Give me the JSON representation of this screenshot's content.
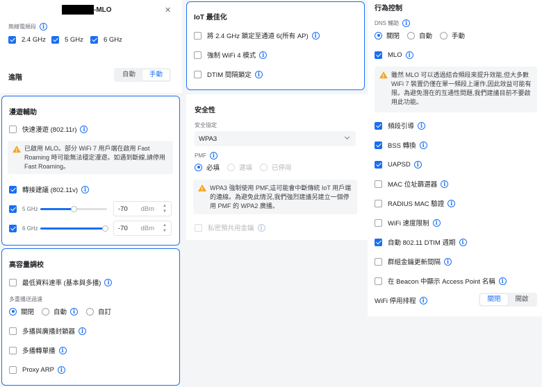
{
  "header": {
    "title_suffix": "-MLO",
    "close_glyph": "✕"
  },
  "radio_band": {
    "label": "無線電頻段",
    "bands": [
      {
        "label": "2.4 GHz",
        "checked": true
      },
      {
        "label": "5 GHz",
        "checked": true
      },
      {
        "label": "6 GHz",
        "checked": true
      }
    ]
  },
  "advanced": {
    "label": "進階",
    "options": [
      "自動",
      "手動"
    ],
    "selected": "手動"
  },
  "roaming": {
    "title": "漫遊輔助",
    "fast_roaming": {
      "label": "快速漫遊 (802.11r)",
      "checked": false
    },
    "warning": "已啟用 MLO。部分 WiFi 7 用戶端在啟用 Fast Roaming 時可能無法穩定漫遊。如遇到斷線,請停用 Fast Roaming。",
    "transition": {
      "label": "轉接建議 (802.11v)",
      "checked": true
    },
    "bands": [
      {
        "label": "5 GHz",
        "checked": true,
        "value": "-70",
        "unit": "dBm",
        "level": 0.5
      },
      {
        "label": "6 GHz",
        "checked": true,
        "value": "-70",
        "unit": "dBm",
        "level": 0.97
      }
    ]
  },
  "high_density": {
    "title": "高容量調校",
    "min_rate": {
      "label": "最低資料速率 (基本與多播)",
      "checked": false
    },
    "multicast_label": "多重播送過濾",
    "multicast_options": [
      "關閉",
      "自動",
      "自訂"
    ],
    "multicast_selected": "關閉",
    "broadcast_block": {
      "label": "多播與廣播封鎖器",
      "checked": false
    },
    "mcast_to_ucast": {
      "label": "多播轉單播",
      "checked": false
    },
    "proxy_arp": {
      "label": "Proxy ARP",
      "checked": false
    }
  },
  "iot": {
    "title": "IoT 最佳化",
    "items": [
      {
        "label": "將 2.4 GHz 鎖定至通道 6(所有 AP)",
        "checked": false
      },
      {
        "label": "強制 WiFi 4 模式",
        "checked": false
      },
      {
        "label": "DTIM 間隔鎖定",
        "checked": false
      }
    ]
  },
  "security": {
    "title": "安全性",
    "protocol_label": "安全協定",
    "protocol_value": "WPA3",
    "pmf_label": "PMF",
    "pmf_options": [
      "必填",
      "選填",
      "已停用"
    ],
    "pmf_selected": "必填",
    "warning": "WPA3 強制使用 PMF,這可能會中斷傳統 IoT 用戶端的連線。為避免此情況,我們強烈建議另建立一個停用 PMF 的 WPA2 廣播。",
    "private_psk": {
      "label": "私密預共用金鑰",
      "checked": false,
      "disabled": true
    }
  },
  "behavior": {
    "title": "行為控制",
    "dns_label": "DNS 輔助",
    "dns_options": [
      "關閉",
      "自動",
      "手動"
    ],
    "dns_selected": "關閉",
    "mlo": {
      "label": "MLO",
      "checked": true
    },
    "mlo_warning": "雖然 MLO 可以透過結合頻段來提升效能,但大多數 WiFi 7 裝置仍僅在單一頻段上運作,因此效益可能有限。為避免潛在的互通性問題,我們建議目前不要啟用此功能。",
    "items": [
      {
        "label": "頻段引導",
        "checked": true
      },
      {
        "label": "BSS 轉換",
        "checked": true
      },
      {
        "label": "UAPSD",
        "checked": true
      },
      {
        "label": "MAC 位址篩選器",
        "checked": false
      },
      {
        "label": "RADIUS MAC 驗證",
        "checked": false
      },
      {
        "label": "WiFi 速度限制",
        "checked": false
      },
      {
        "label": "自動 802.11 DTIM 週期",
        "checked": true
      },
      {
        "label": "群組金鑰更新間隔",
        "checked": false
      },
      {
        "label": "在 Beacon 中顯示 Access Point 名稱",
        "checked": false
      }
    ],
    "schedule_label": "WiFi 停用排程",
    "schedule_options": [
      "關閉",
      "開啟"
    ],
    "schedule_selected": "關閉"
  }
}
